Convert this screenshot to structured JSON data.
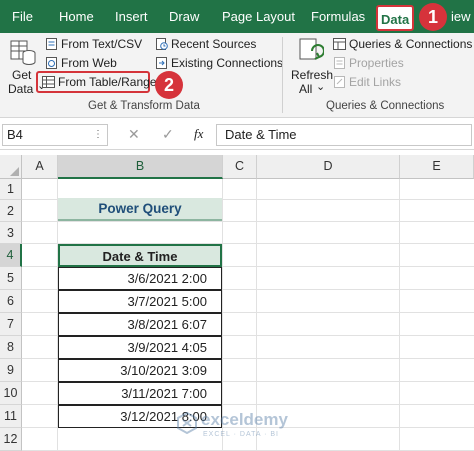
{
  "ribbon": {
    "tabs": [
      {
        "label": "File"
      },
      {
        "label": "Home"
      },
      {
        "label": "Insert"
      },
      {
        "label": "Draw"
      },
      {
        "label": "Page Layout"
      },
      {
        "label": "Formulas"
      },
      {
        "label": "Data"
      },
      {
        "label": "iew"
      }
    ],
    "callouts": [
      "1",
      "2"
    ],
    "get_data": {
      "line1": "Get",
      "line2": "Data",
      "arrow": "⌄"
    },
    "get_transform": {
      "from_text_csv": "From Text/CSV",
      "from_web": "From Web",
      "from_table_range": "From Table/Range",
      "recent_sources": "Recent Sources",
      "existing_connections": "Existing Connections",
      "group_label": "Get & Transform Data"
    },
    "refresh_all": {
      "line1": "Refresh",
      "line2": "All",
      "arrow": "⌄"
    },
    "queries_connections": {
      "queries_connections": "Queries & Connections",
      "properties": "Properties",
      "edit_links": "Edit Links",
      "group_label": "Queries & Connections"
    },
    "accent": "#217346",
    "highlight": "#d4343a"
  },
  "formula_bar": {
    "name_box": "B4",
    "cancel": "✕",
    "enter": "✓",
    "fx": "fx",
    "content": "Date & Time"
  },
  "sheet": {
    "columns": [
      "A",
      "B",
      "C",
      "D",
      "E"
    ],
    "rows": [
      "1",
      "2",
      "3",
      "4",
      "5",
      "6",
      "7",
      "8",
      "9",
      "10",
      "11",
      "12"
    ],
    "title_cell": "Power Query",
    "title_fill": "#d9e8df",
    "table": {
      "header": "Date & Time",
      "header_fill": "#d9e8df",
      "values": [
        "3/6/2021 2:00",
        "3/7/2021 5:00",
        "3/8/2021 6:07",
        "3/9/2021 4:05",
        "3/10/2021 3:09",
        "3/11/2021 7:00",
        "3/12/2021 8:00"
      ]
    }
  },
  "watermark": {
    "brand": "exceldemy",
    "tagline": "EXCEL · DATA · BI"
  }
}
